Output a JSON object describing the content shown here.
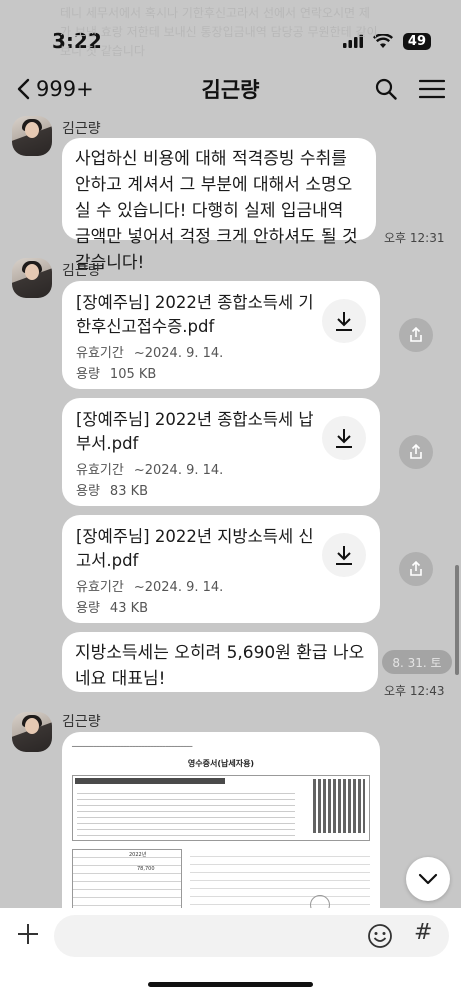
{
  "status_bar": {
    "time": "3:22",
    "battery": "49",
    "icons": [
      "signal-icon",
      "wifi-icon",
      "battery-icon"
    ]
  },
  "background_ghost_text": "테니 세무서에서 혹시나 기한후신고라서 선에서 연락오시면 제가 보낸 효랑 저한테 보내신 통장입금내역 담당공 무원한테 같이 보니 첫 같습니다",
  "header": {
    "back_label": "999+",
    "title": "김근량"
  },
  "messages": [
    {
      "sender": "김근량",
      "text": "사업하신 비용에 대해 적격증빙 수취를 안하고 계셔서 그 부분에 대해서 소명오실 수 있습니다! 다행히 실제 입금내역 금액만 넣어서 걱정 크게 안하셔도 될 것 같습니다!",
      "time": "오후 12:31"
    },
    {
      "sender": "김근량",
      "files": [
        {
          "name": "[장예주님] 2022년 종합소득세 기한후신고접수증.pdf",
          "expiry_label": "유효기간",
          "expiry": "~2024. 9. 14.",
          "size_label": "용량",
          "size": "105 KB"
        },
        {
          "name": "[장예주님] 2022년 종합소득세 납부서.pdf",
          "expiry_label": "유효기간",
          "expiry": "~2024. 9. 14.",
          "size_label": "용량",
          "size": "83 KB"
        },
        {
          "name": "[장예주님] 2022년 지방소득세 신고서.pdf",
          "expiry_label": "유효기간",
          "expiry": "~2024. 9. 14.",
          "size_label": "용량",
          "size": "43 KB"
        }
      ],
      "followup_text": "지방소득세는 오히려 5,690원 환급 나오네요 대표님!",
      "time": "오후 12:43"
    },
    {
      "sender": "김근량",
      "image": {
        "doc_title": "영수증서(납세자용)",
        "doc_year": "2022년",
        "doc_amount": "78,700"
      }
    }
  ],
  "date_chip": "8. 31. 토",
  "colors": {
    "background": "#c7c7c7",
    "bubble": "#ffffff"
  }
}
